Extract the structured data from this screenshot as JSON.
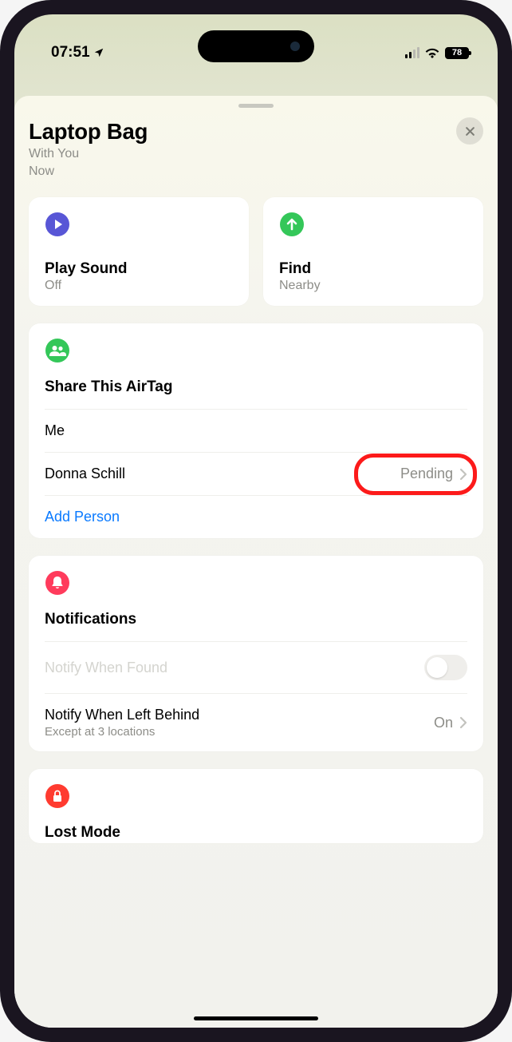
{
  "status": {
    "time": "07:51",
    "battery": "78"
  },
  "header": {
    "title": "Laptop Bag",
    "line1": "With You",
    "line2": "Now"
  },
  "actions": {
    "play": {
      "title": "Play Sound",
      "sub": "Off"
    },
    "find": {
      "title": "Find",
      "sub": "Nearby"
    }
  },
  "share": {
    "title": "Share This AirTag",
    "me": "Me",
    "person": {
      "name": "Donna Schill",
      "status": "Pending"
    },
    "add": "Add Person"
  },
  "notifications": {
    "title": "Notifications",
    "found": "Notify When Found",
    "left": {
      "title": "Notify When Left Behind",
      "sub": "Except at 3 locations",
      "value": "On"
    }
  },
  "lost": {
    "title": "Lost Mode"
  }
}
